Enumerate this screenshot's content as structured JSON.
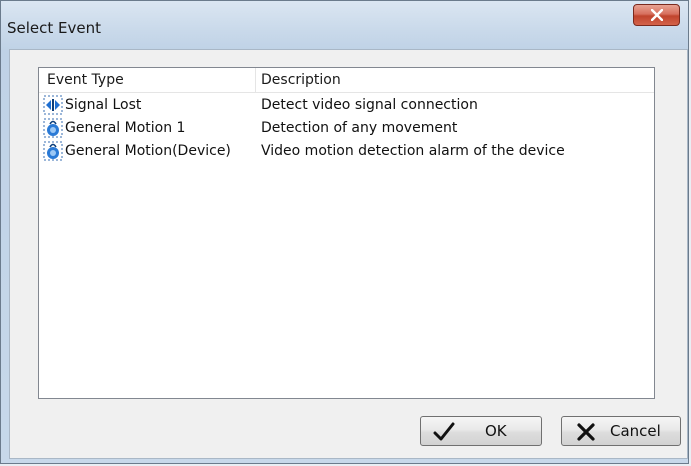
{
  "window": {
    "title": "Select Event"
  },
  "list": {
    "columns": [
      "Event Type",
      "Description"
    ],
    "rows": [
      {
        "type": "Signal Lost",
        "description": "Detect video signal connection",
        "icon": "signal-lost-icon"
      },
      {
        "type": "General Motion 1",
        "description": "Detection of any movement",
        "icon": "motion-icon"
      },
      {
        "type": "General Motion(Device)",
        "description": "Video motion detection alarm of the device",
        "icon": "motion-icon"
      }
    ]
  },
  "buttons": {
    "ok_label": "OK",
    "cancel_label": "Cancel"
  },
  "colors": {
    "close_button": "#c0442d",
    "accent": "#1f6fd1"
  }
}
